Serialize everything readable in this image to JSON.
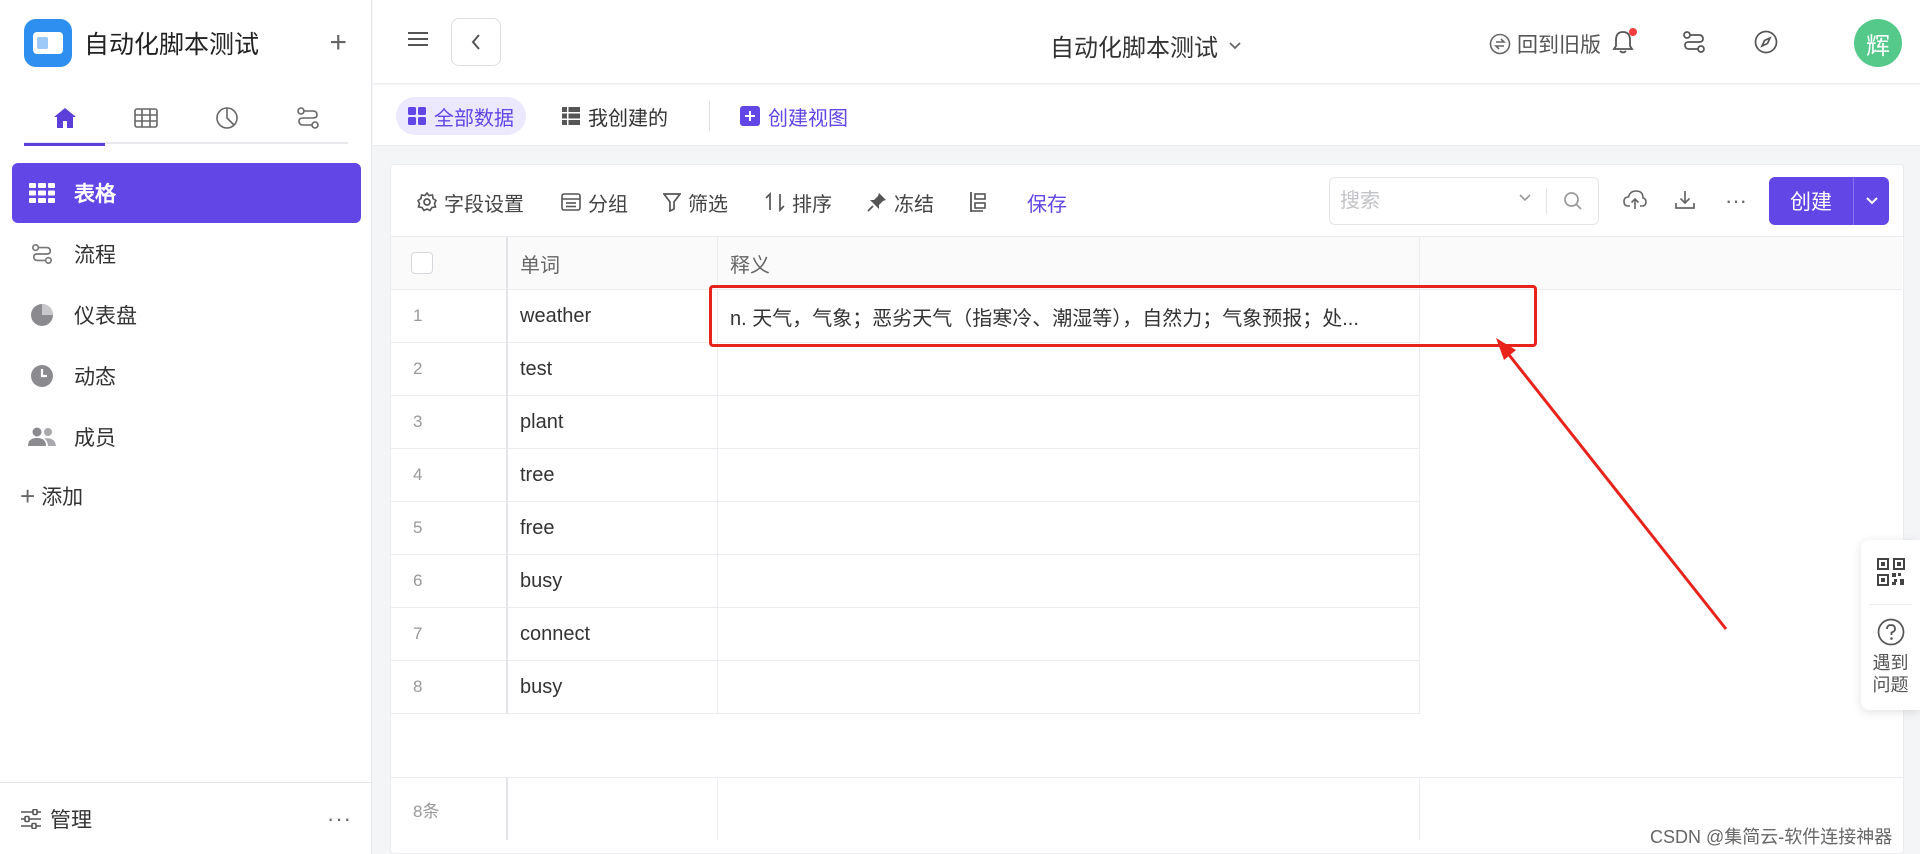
{
  "app": {
    "name": "自动化脚本测试"
  },
  "sidebar": {
    "tabs": [
      "home-icon",
      "table-icon",
      "dashboard-icon",
      "flow-icon"
    ],
    "items": [
      {
        "label": "表格",
        "icon": "grid-icon",
        "active": true
      },
      {
        "label": "流程",
        "icon": "flow-icon"
      },
      {
        "label": "仪表盘",
        "icon": "pie-icon"
      },
      {
        "label": "动态",
        "icon": "clock-icon"
      },
      {
        "label": "成员",
        "icon": "people-icon"
      }
    ],
    "add_label": "添加",
    "manage_label": "管理",
    "more": "···"
  },
  "header": {
    "title": "自动化脚本测试",
    "old_version": "回到旧版",
    "avatar": "辉"
  },
  "views": {
    "all": "全部数据",
    "mine": "我创建的",
    "create": "创建视图"
  },
  "toolbar": {
    "fields": "字段设置",
    "group": "分组",
    "filter": "筛选",
    "sort": "排序",
    "freeze": "冻结",
    "save": "保存",
    "search_placeholder": "搜索",
    "create": "创建",
    "more": "···"
  },
  "table": {
    "columns": [
      "单词",
      "释义"
    ],
    "rows": [
      {
        "idx": "1",
        "word": "weather",
        "def": "n. 天气，气象；恶劣天气（指寒冷、潮湿等），自然力；气象预报；处..."
      },
      {
        "idx": "2",
        "word": "test",
        "def": ""
      },
      {
        "idx": "3",
        "word": "plant",
        "def": ""
      },
      {
        "idx": "4",
        "word": "tree",
        "def": ""
      },
      {
        "idx": "5",
        "word": "free",
        "def": ""
      },
      {
        "idx": "6",
        "word": "busy",
        "def": ""
      },
      {
        "idx": "7",
        "word": "connect",
        "def": ""
      },
      {
        "idx": "8",
        "word": "busy",
        "def": ""
      }
    ],
    "count": "8条"
  },
  "float_panel": {
    "help": "遇到问题"
  },
  "watermark": "CSDN @集简云-软件连接神器",
  "colors": {
    "accent": "#6346e6",
    "annotation": "#e8231b",
    "avatar": "#54c98a"
  }
}
